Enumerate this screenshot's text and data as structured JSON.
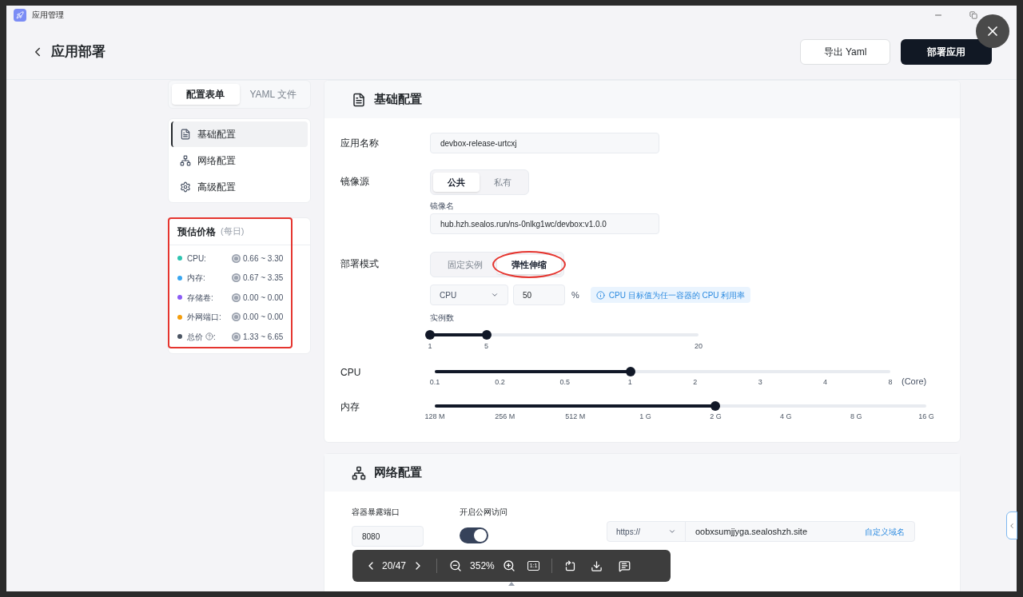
{
  "app_window": {
    "title": "应用管理"
  },
  "header": {
    "title": "应用部署",
    "buttons": [
      {
        "label": "导出 Yaml",
        "kind": "outline"
      },
      {
        "label": "部署应用",
        "kind": "primary"
      }
    ]
  },
  "view_tabs": [
    {
      "label": "配置表单",
      "selected": true
    },
    {
      "label": "YAML 文件",
      "selected": false
    }
  ],
  "nav": [
    {
      "label": "基础配置",
      "selected": true
    },
    {
      "label": "网络配置",
      "selected": false
    },
    {
      "label": "高级配置",
      "selected": false
    }
  ],
  "price": {
    "title": "预估价格",
    "period": "(每日)",
    "circled": true,
    "items": [
      {
        "label": "CPU:",
        "color": "#2ec4b0",
        "range": "0.66 ~ 3.30",
        "help": false
      },
      {
        "label": "内存:",
        "color": "#38a6f0",
        "range": "0.67 ~ 3.35",
        "help": false
      },
      {
        "label": "存储卷:",
        "color": "#8b5cf6",
        "range": "0.00 ~ 0.00",
        "help": false
      },
      {
        "label": "外网端口:",
        "color": "#f59e0b",
        "range": "0.00 ~ 0.00",
        "help": false
      },
      {
        "label": "总价",
        "label_end": ":",
        "color": "#4b5563",
        "range": "1.33 ~ 6.65",
        "help": true
      }
    ]
  },
  "basic": {
    "title": "基础配置",
    "app_name": {
      "label": "应用名称",
      "value": "devbox-release-urtcxj"
    },
    "image_source": {
      "label": "镜像源",
      "options": [
        {
          "label": "公共",
          "selected": true,
          "circled": false
        },
        {
          "label": "私有",
          "selected": false,
          "circled": false
        }
      ],
      "image_label": "镜像名",
      "image_value": "hub.hzh.sealos.run/ns-0nlkg1wc/devbox:v1.0.0"
    },
    "deploy_mode": {
      "label": "部署模式",
      "options": [
        {
          "label": "固定实例",
          "selected": false,
          "circled": false
        },
        {
          "label": "弹性伸缩",
          "selected": true,
          "circled": true
        }
      ],
      "metric": "CPU",
      "target": "50",
      "unit": "%",
      "hint": "CPU 目标值为任一容器的 CPU 利用率",
      "instances": {
        "label": "实例数",
        "level": 0.21,
        "ticks": [
          "1",
          "5",
          "20"
        ]
      }
    },
    "cpu": {
      "label": "CPU",
      "level": 0.43,
      "ticks": [
        "0.1",
        "0.2",
        "0.5",
        "1",
        "2",
        "3",
        "4",
        "8"
      ],
      "unit": "(Core)"
    },
    "memory": {
      "label": "内存",
      "level": 0.57,
      "ticks": [
        "128 M",
        "256 M",
        "512 M",
        "1 G",
        "2 G",
        "4 G",
        "8 G",
        "16 G"
      ]
    }
  },
  "network": {
    "title": "网络配置",
    "port_label": "容器暴露端口",
    "port": "8080",
    "public_label": "开启公网访问",
    "public_on": true,
    "protocol": "https://",
    "domain": "oobxsumjjyga.sealoshzh.site",
    "custom_domain": "自定义域名"
  },
  "viewer": {
    "page": "20/47",
    "zoom": "352%",
    "actual_size": "1:1"
  }
}
